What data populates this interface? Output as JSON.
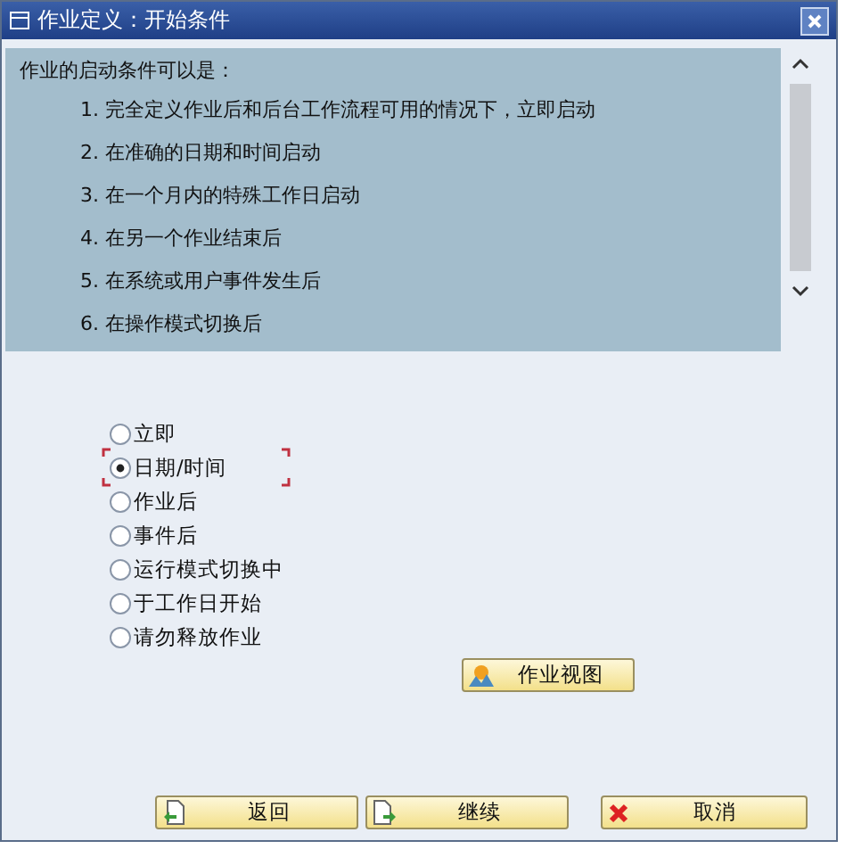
{
  "window": {
    "title": "作业定义：开始条件"
  },
  "info": {
    "heading": "作业的启动条件可以是：",
    "items": [
      "1. 完全定义作业后和后台工作流程可用的情况下，立即启动",
      "2. 在准确的日期和时间启动",
      "3. 在一个月内的特殊工作日启动",
      "4. 在另一个作业结束后",
      "5. 在系统或用户事件发生后",
      "6. 在操作模式切换后"
    ]
  },
  "options": [
    {
      "label": "立即",
      "selected": false
    },
    {
      "label": "日期/时间",
      "selected": true
    },
    {
      "label": "作业后",
      "selected": false
    },
    {
      "label": "事件后",
      "selected": false
    },
    {
      "label": "运行模式切换中",
      "selected": false
    },
    {
      "label": "于工作日开始",
      "selected": false
    },
    {
      "label": "请勿释放作业",
      "selected": false
    }
  ],
  "job_view_button": {
    "label": "作业视图"
  },
  "buttons": [
    {
      "kind": "back",
      "label": "返回"
    },
    {
      "kind": "continue",
      "label": "继续"
    },
    {
      "kind": "cancel",
      "label": "取消"
    }
  ]
}
